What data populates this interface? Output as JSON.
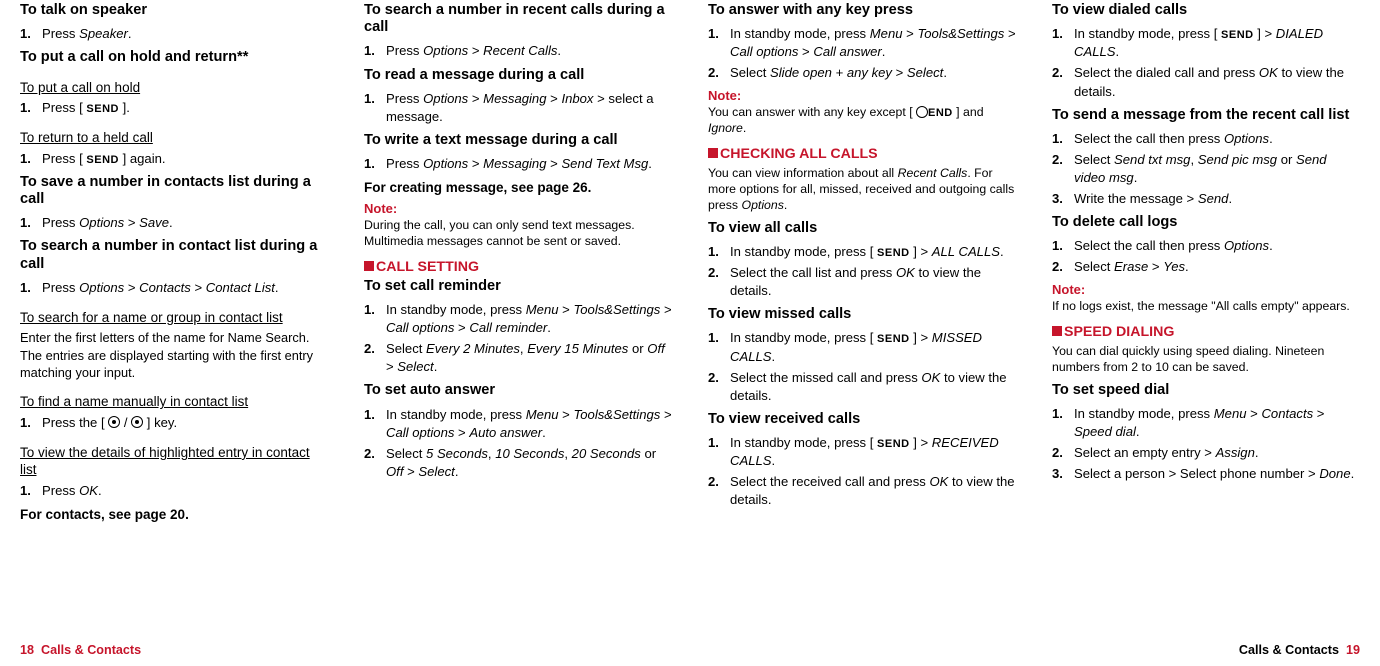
{
  "footer": {
    "left_page": "18",
    "right_page": "19",
    "section": "Calls & Contacts"
  },
  "icons": {
    "send": "SEND",
    "end": "END"
  },
  "col1": {
    "h_talk": "To talk on speaker",
    "s_talk_1": "Press ",
    "s_talk_1b": "Speaker",
    "s_talk_1c": ".",
    "h_hold": "To put a call on hold and return**",
    "u_put": "To put a call on hold",
    "s_put_1a": "Press [ ",
    "s_put_1b": " ].",
    "u_return": "To return to a held call",
    "s_return_1a": "Press [ ",
    "s_return_1b": " ] again.",
    "h_savenum": "To save a number in contacts list during a call",
    "s_save_1a": "Press ",
    "s_save_1b": "Options",
    "s_save_1c": " > ",
    "s_save_1d": "Save",
    "s_save_1e": ".",
    "h_searchlist": "To search a number in contact list during a call",
    "s_search_1a": "Press ",
    "s_search_1b": "Options",
    "s_search_1c": " > ",
    "s_search_1d": "Contacts",
    "s_search_1e": " > ",
    "s_search_1f": "Contact List",
    "s_search_1g": ".",
    "u_namegroup": "To search for a name or group in contact list",
    "body_namegroup": "Enter the first letters of the name for Name Search. The entries are displayed starting with the first entry matching your input.",
    "u_findmanual": "To find a name manually in contact list",
    "s_find_1a": "Press the [ ",
    "s_find_1b": " / ",
    "s_find_1c": " ] key.",
    "u_viewdetails": "To view the details of highlighted entry in contact list",
    "s_view_1a": "Press ",
    "s_view_1b": "OK",
    "s_view_1c": ".",
    "for_contacts": "For contacts, see page 20."
  },
  "col2": {
    "h_searchrecent": "To search a number in recent calls during a call",
    "s_sr_1a": "Press ",
    "s_sr_1b": "Options",
    "s_sr_1c": " > ",
    "s_sr_1d": "Recent Calls",
    "s_sr_1e": ".",
    "h_readmsg": "To read a message during a call",
    "s_rm_1a": "Press ",
    "s_rm_1b": "Options",
    "s_rm_1c": " > ",
    "s_rm_1d": "Messaging",
    "s_rm_1e": " > ",
    "s_rm_1f": "Inbox",
    "s_rm_1g": " > select a message.",
    "h_writemsg": "To write a text message during a call",
    "s_wm_1a": "Press ",
    "s_wm_1b": "Options",
    "s_wm_1c": " > ",
    "s_wm_1d": "Messaging",
    "s_wm_1e": " > ",
    "s_wm_1f": "Send Text Msg",
    "s_wm_1g": ".",
    "for_createmsg": "For creating message, see page 26.",
    "note_label": "Note:",
    "note_text": "During the call, you can only send text messages. Multimedia messages cannot be sent or saved.",
    "sec_callsetting": "CALL SETTING",
    "h_reminder": "To set call reminder",
    "s_rem_1a": "In standby mode, press ",
    "s_rem_1b": "Menu",
    "s_rem_1d": "Tools&Settings",
    "s_rem_1f": "Call options",
    "s_rem_1h": "Call reminder",
    "s_rem_2a": "Select ",
    "s_rem_2b": "Every 2 Minutes",
    "s_rem_2c": ", ",
    "s_rem_2d": "Every 15 Minutes",
    "s_rem_2e": " or ",
    "s_rem_2f": "Off",
    "s_rem_2h": "Select",
    "h_auto": "To set auto answer",
    "s_auto_1a": "In standby mode, press ",
    "s_auto_1b": "Menu",
    "s_auto_1d": "Tools&Settings",
    "s_auto_1f": "Call options",
    "s_auto_1h": "Auto answer",
    "s_auto_2a": "Select ",
    "s_auto_2b": "5 Seconds",
    "s_auto_2d": "10 Seconds",
    "s_auto_2f": "20 Seconds",
    "s_auto_2h": "Off",
    "s_auto_2j": "Select"
  },
  "col3": {
    "h_anykey": "To answer with any key press",
    "s_ak_1a": "In standby mode, press ",
    "s_ak_1b": "Menu",
    "s_ak_1d": "Tools&Settings",
    "s_ak_1f": "Call options",
    "s_ak_1h": "Call answer",
    "s_ak_2a": "Select ",
    "s_ak_2b": "Slide open + any key",
    "s_ak_2d": "Select",
    "note_label": "Note:",
    "note_text_a": "You can answer with any key except [ ",
    "note_text_b": " ] and ",
    "note_text_c": "Ignore",
    "note_text_d": ".",
    "sec_check": "CHECKING ALL CALLS",
    "body_check_a": "You can view information about all ",
    "body_check_b": "Recent Calls",
    "body_check_c": ". For more options for all, missed, received and outgoing calls press ",
    "body_check_d": "Options",
    "body_check_e": ".",
    "h_viewall": "To view all calls",
    "s_va_1a": "In standby mode, press [ ",
    "s_va_1b": " ] > ",
    "s_va_1c": "ALL CALLS",
    "s_va_2a": "Select the call list and press ",
    "s_va_2b": "OK",
    "s_va_2c": " to view the details.",
    "h_missed": "To view missed calls",
    "s_ms_1a": "In standby mode, press [ ",
    "s_ms_1b": " ] > ",
    "s_ms_1c": "MISSED CALLS",
    "s_ms_2a": "Select the missed call and press ",
    "s_ms_2b": "OK",
    "s_ms_2c": " to view the details.",
    "h_received": "To view received calls",
    "s_rv_1a": "In standby mode, press [ ",
    "s_rv_1b": " ] > ",
    "s_rv_1c": "RECEIVED CALLS",
    "s_rv_2a": "Select the received call and press ",
    "s_rv_2b": "OK",
    "s_rv_2c": " to view the details."
  },
  "col4": {
    "h_dialed": "To view dialed calls",
    "s_dl_1a": "In standby mode, press [ ",
    "s_dl_1b": " ] > ",
    "s_dl_1c": "DIALED CALLS",
    "s_dl_2a": "Select the dialed call and press ",
    "s_dl_2b": "OK",
    "s_dl_2c": " to view the details.",
    "h_sendmsg": "To send a message from the recent call list",
    "s_sm_1a": "Select the call then press ",
    "s_sm_1b": "Options",
    "s_sm_2a": "Select ",
    "s_sm_2b": "Send txt msg",
    "s_sm_2c": ", ",
    "s_sm_2d": "Send pic msg",
    "s_sm_2e": " or ",
    "s_sm_2f": "Send video msg",
    "s_sm_3a": "Write the message > ",
    "s_sm_3b": "Send",
    "h_delete": "To delete call logs",
    "s_del_1a": "Select the call then press ",
    "s_del_1b": "Options",
    "s_del_2a": "Select ",
    "s_del_2b": "Erase",
    "s_del_2d": "Yes",
    "note_label": "Note:",
    "note_text": "If no logs exist, the message \"All calls empty\" appears.",
    "sec_speed": "SPEED DIALING",
    "body_speed": "You can dial quickly using speed dialing. Nineteen numbers from 2 to 10 can be saved.",
    "h_setspeed": "To set speed dial",
    "s_sp_1a": "In standby mode, press ",
    "s_sp_1b": "Menu",
    "s_sp_1d": "Contacts",
    "s_sp_1f": "Speed dial",
    "s_sp_2a": "Select an empty entry > ",
    "s_sp_2b": "Assign",
    "s_sp_3a": "Select a person > Select phone number > ",
    "s_sp_3b": "Done"
  }
}
